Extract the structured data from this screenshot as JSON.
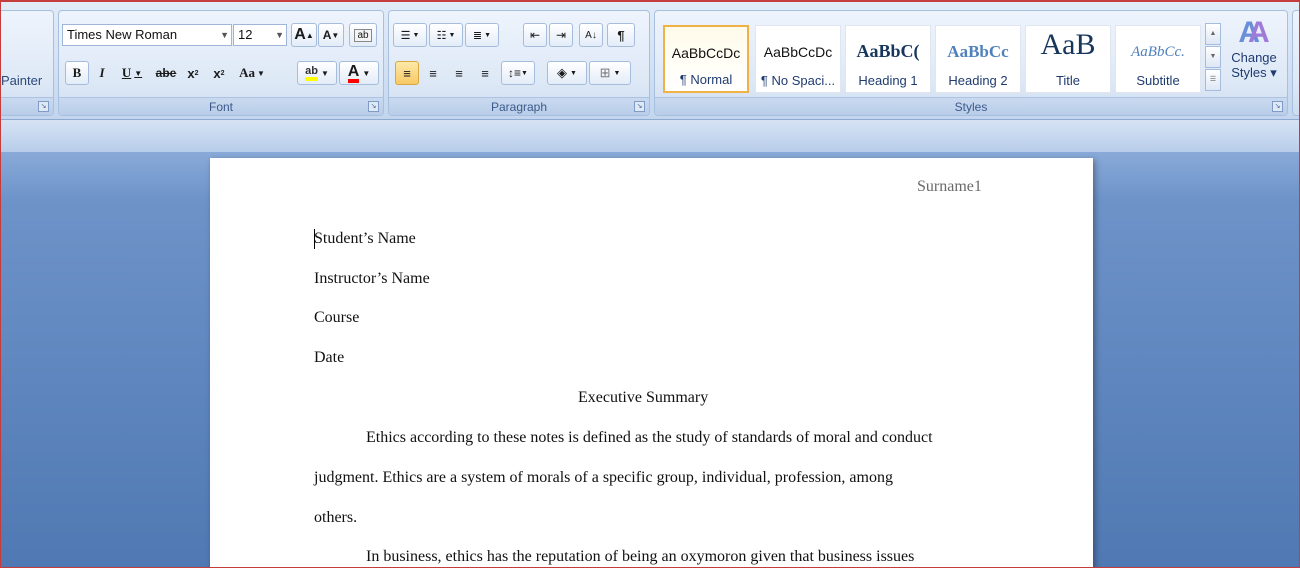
{
  "clipboard": {
    "painter_label": "Painter"
  },
  "font": {
    "group_label": "Font",
    "font_name": "Times New Roman",
    "font_size": "12",
    "grow_label": "A",
    "shrink_label": "A",
    "bold": "B",
    "italic": "I",
    "underline": "U",
    "strike": "abe",
    "subscript": "x",
    "superscript": "x",
    "change_case": "Aa",
    "highlight": "ab",
    "font_color": "A",
    "highlight_color": "#ffff00",
    "font_color_value": "#ff0000"
  },
  "paragraph": {
    "group_label": "Paragraph"
  },
  "styles": {
    "group_label": "Styles",
    "cards": [
      {
        "sample": "AaBbCcDc",
        "name": "¶ Normal"
      },
      {
        "sample": "AaBbCcDc",
        "name": "¶ No Spaci..."
      },
      {
        "sample": "AaBbC(",
        "name": "Heading 1"
      },
      {
        "sample": "AaBbCc",
        "name": "Heading 2"
      },
      {
        "sample": "AaB",
        "name": "Title"
      },
      {
        "sample": "AaBbCc.",
        "name": "Subtitle"
      }
    ],
    "change_styles_line1": "Change",
    "change_styles_line2": "Styles ▾"
  },
  "document": {
    "header": "Surname1",
    "lines": [
      "Student’s Name",
      "Instructor’s Name",
      "Course",
      "Date"
    ],
    "title": "Executive Summary",
    "para1_line1": "Ethics according to these notes is defined as the study of standards of moral and conduct",
    "para1_line2": "judgment. Ethics are a system of morals of a specific group, individual, profession, among",
    "para1_line3": "others.",
    "para2_line1": "In business, ethics has the reputation of being an oxymoron given that business issues"
  }
}
